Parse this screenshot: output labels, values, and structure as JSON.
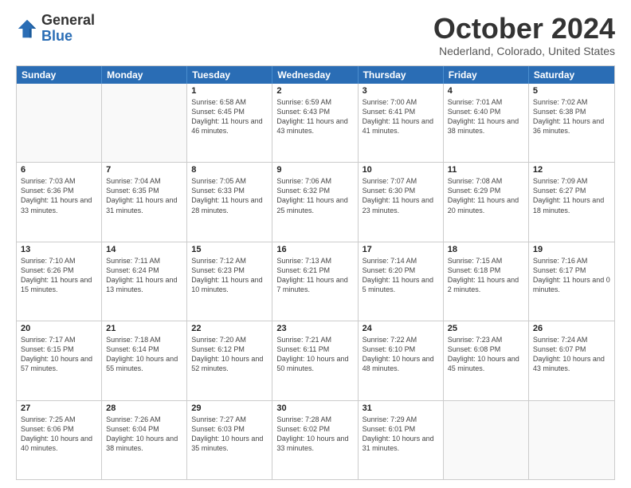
{
  "header": {
    "logo_general": "General",
    "logo_blue": "Blue",
    "month_title": "October 2024",
    "location": "Nederland, Colorado, United States"
  },
  "calendar": {
    "days_of_week": [
      "Sunday",
      "Monday",
      "Tuesday",
      "Wednesday",
      "Thursday",
      "Friday",
      "Saturday"
    ],
    "weeks": [
      [
        {
          "day": "",
          "empty": true
        },
        {
          "day": "",
          "empty": true
        },
        {
          "day": "1",
          "sunrise": "Sunrise: 6:58 AM",
          "sunset": "Sunset: 6:45 PM",
          "daylight": "Daylight: 11 hours and 46 minutes."
        },
        {
          "day": "2",
          "sunrise": "Sunrise: 6:59 AM",
          "sunset": "Sunset: 6:43 PM",
          "daylight": "Daylight: 11 hours and 43 minutes."
        },
        {
          "day": "3",
          "sunrise": "Sunrise: 7:00 AM",
          "sunset": "Sunset: 6:41 PM",
          "daylight": "Daylight: 11 hours and 41 minutes."
        },
        {
          "day": "4",
          "sunrise": "Sunrise: 7:01 AM",
          "sunset": "Sunset: 6:40 PM",
          "daylight": "Daylight: 11 hours and 38 minutes."
        },
        {
          "day": "5",
          "sunrise": "Sunrise: 7:02 AM",
          "sunset": "Sunset: 6:38 PM",
          "daylight": "Daylight: 11 hours and 36 minutes."
        }
      ],
      [
        {
          "day": "6",
          "sunrise": "Sunrise: 7:03 AM",
          "sunset": "Sunset: 6:36 PM",
          "daylight": "Daylight: 11 hours and 33 minutes."
        },
        {
          "day": "7",
          "sunrise": "Sunrise: 7:04 AM",
          "sunset": "Sunset: 6:35 PM",
          "daylight": "Daylight: 11 hours and 31 minutes."
        },
        {
          "day": "8",
          "sunrise": "Sunrise: 7:05 AM",
          "sunset": "Sunset: 6:33 PM",
          "daylight": "Daylight: 11 hours and 28 minutes."
        },
        {
          "day": "9",
          "sunrise": "Sunrise: 7:06 AM",
          "sunset": "Sunset: 6:32 PM",
          "daylight": "Daylight: 11 hours and 25 minutes."
        },
        {
          "day": "10",
          "sunrise": "Sunrise: 7:07 AM",
          "sunset": "Sunset: 6:30 PM",
          "daylight": "Daylight: 11 hours and 23 minutes."
        },
        {
          "day": "11",
          "sunrise": "Sunrise: 7:08 AM",
          "sunset": "Sunset: 6:29 PM",
          "daylight": "Daylight: 11 hours and 20 minutes."
        },
        {
          "day": "12",
          "sunrise": "Sunrise: 7:09 AM",
          "sunset": "Sunset: 6:27 PM",
          "daylight": "Daylight: 11 hours and 18 minutes."
        }
      ],
      [
        {
          "day": "13",
          "sunrise": "Sunrise: 7:10 AM",
          "sunset": "Sunset: 6:26 PM",
          "daylight": "Daylight: 11 hours and 15 minutes."
        },
        {
          "day": "14",
          "sunrise": "Sunrise: 7:11 AM",
          "sunset": "Sunset: 6:24 PM",
          "daylight": "Daylight: 11 hours and 13 minutes."
        },
        {
          "day": "15",
          "sunrise": "Sunrise: 7:12 AM",
          "sunset": "Sunset: 6:23 PM",
          "daylight": "Daylight: 11 hours and 10 minutes."
        },
        {
          "day": "16",
          "sunrise": "Sunrise: 7:13 AM",
          "sunset": "Sunset: 6:21 PM",
          "daylight": "Daylight: 11 hours and 7 minutes."
        },
        {
          "day": "17",
          "sunrise": "Sunrise: 7:14 AM",
          "sunset": "Sunset: 6:20 PM",
          "daylight": "Daylight: 11 hours and 5 minutes."
        },
        {
          "day": "18",
          "sunrise": "Sunrise: 7:15 AM",
          "sunset": "Sunset: 6:18 PM",
          "daylight": "Daylight: 11 hours and 2 minutes."
        },
        {
          "day": "19",
          "sunrise": "Sunrise: 7:16 AM",
          "sunset": "Sunset: 6:17 PM",
          "daylight": "Daylight: 11 hours and 0 minutes."
        }
      ],
      [
        {
          "day": "20",
          "sunrise": "Sunrise: 7:17 AM",
          "sunset": "Sunset: 6:15 PM",
          "daylight": "Daylight: 10 hours and 57 minutes."
        },
        {
          "day": "21",
          "sunrise": "Sunrise: 7:18 AM",
          "sunset": "Sunset: 6:14 PM",
          "daylight": "Daylight: 10 hours and 55 minutes."
        },
        {
          "day": "22",
          "sunrise": "Sunrise: 7:20 AM",
          "sunset": "Sunset: 6:12 PM",
          "daylight": "Daylight: 10 hours and 52 minutes."
        },
        {
          "day": "23",
          "sunrise": "Sunrise: 7:21 AM",
          "sunset": "Sunset: 6:11 PM",
          "daylight": "Daylight: 10 hours and 50 minutes."
        },
        {
          "day": "24",
          "sunrise": "Sunrise: 7:22 AM",
          "sunset": "Sunset: 6:10 PM",
          "daylight": "Daylight: 10 hours and 48 minutes."
        },
        {
          "day": "25",
          "sunrise": "Sunrise: 7:23 AM",
          "sunset": "Sunset: 6:08 PM",
          "daylight": "Daylight: 10 hours and 45 minutes."
        },
        {
          "day": "26",
          "sunrise": "Sunrise: 7:24 AM",
          "sunset": "Sunset: 6:07 PM",
          "daylight": "Daylight: 10 hours and 43 minutes."
        }
      ],
      [
        {
          "day": "27",
          "sunrise": "Sunrise: 7:25 AM",
          "sunset": "Sunset: 6:06 PM",
          "daylight": "Daylight: 10 hours and 40 minutes."
        },
        {
          "day": "28",
          "sunrise": "Sunrise: 7:26 AM",
          "sunset": "Sunset: 6:04 PM",
          "daylight": "Daylight: 10 hours and 38 minutes."
        },
        {
          "day": "29",
          "sunrise": "Sunrise: 7:27 AM",
          "sunset": "Sunset: 6:03 PM",
          "daylight": "Daylight: 10 hours and 35 minutes."
        },
        {
          "day": "30",
          "sunrise": "Sunrise: 7:28 AM",
          "sunset": "Sunset: 6:02 PM",
          "daylight": "Daylight: 10 hours and 33 minutes."
        },
        {
          "day": "31",
          "sunrise": "Sunrise: 7:29 AM",
          "sunset": "Sunset: 6:01 PM",
          "daylight": "Daylight: 10 hours and 31 minutes."
        },
        {
          "day": "",
          "empty": true
        },
        {
          "day": "",
          "empty": true
        }
      ]
    ]
  }
}
